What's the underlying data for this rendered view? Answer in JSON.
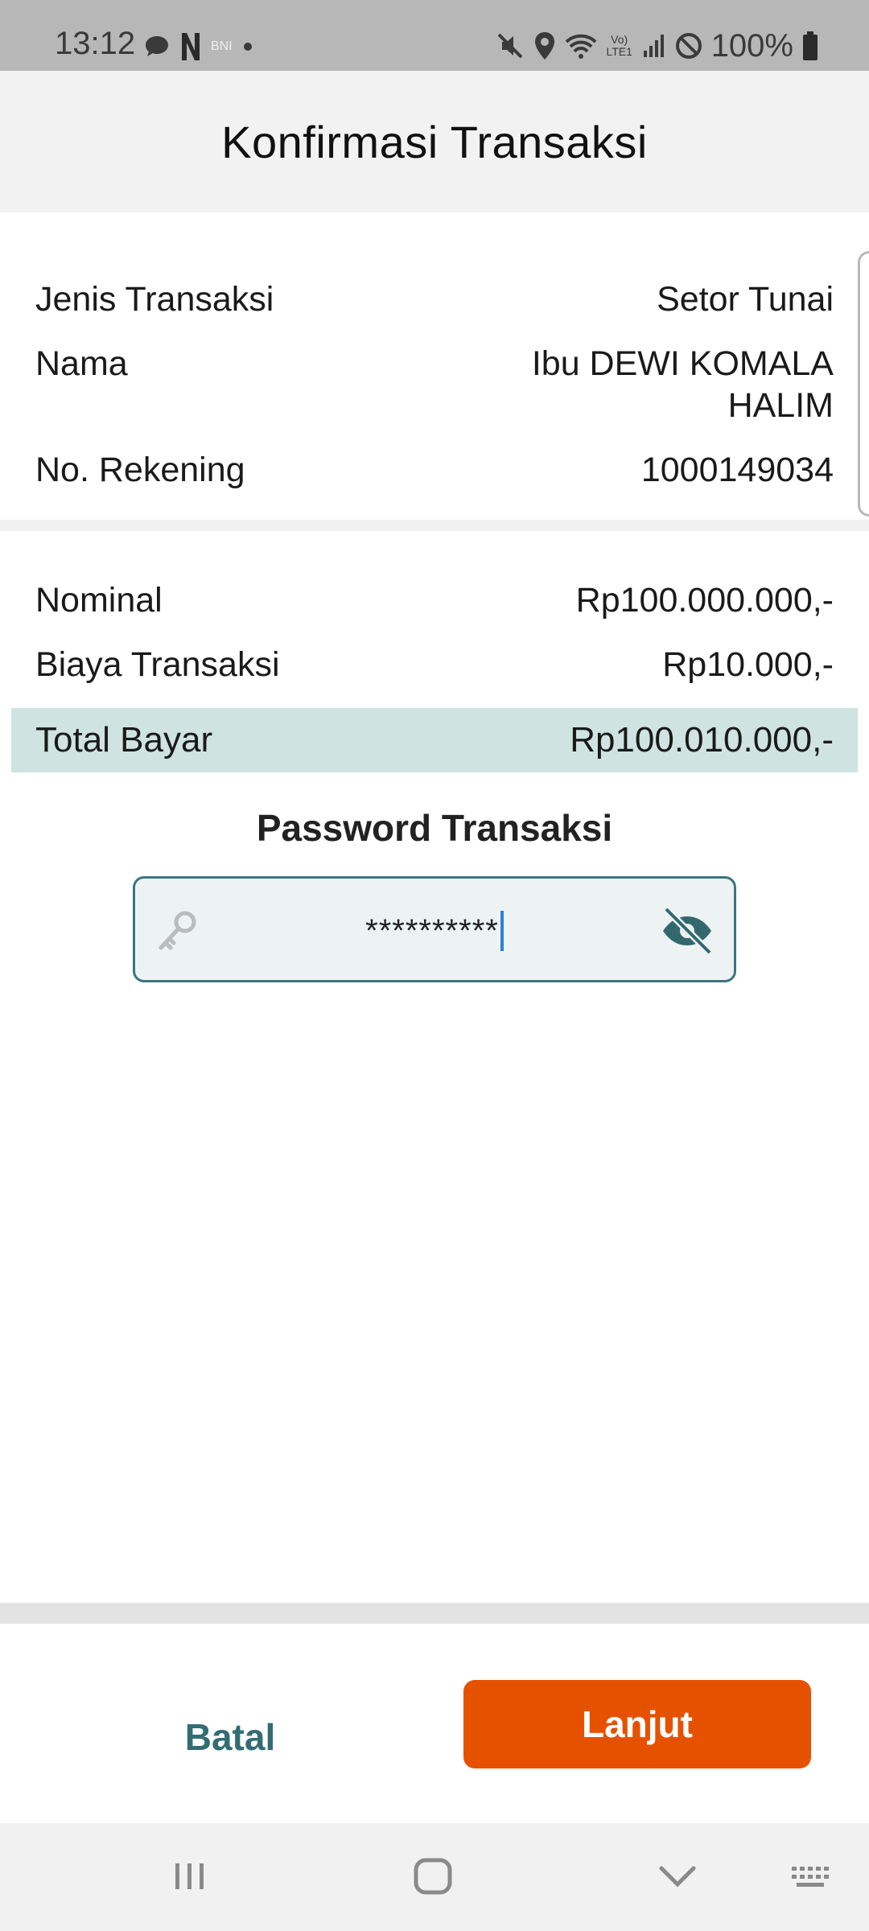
{
  "status_bar": {
    "time": "13:12",
    "carrier_label": "BNI",
    "network_label": "Vo) LTE1",
    "battery": "100%"
  },
  "header": {
    "title": "Konfirmasi Transaksi"
  },
  "details": {
    "transaction_type_label": "Jenis Transaksi",
    "transaction_type_value": "Setor Tunai",
    "name_label": "Nama",
    "name_value": "Ibu DEWI KOMALA HALIM",
    "account_label": "No. Rekening",
    "account_value": "1000149034"
  },
  "amounts": {
    "nominal_label": "Nominal",
    "nominal_value": "Rp100.000.000,-",
    "fee_label": "Biaya Transaksi",
    "fee_value": "Rp10.000,-",
    "total_label": "Total Bayar",
    "total_value": "Rp100.010.000,-"
  },
  "password": {
    "title": "Password Transaksi",
    "value": "**********"
  },
  "actions": {
    "cancel_label": "Batal",
    "next_label": "Lanjut"
  },
  "colors": {
    "accent_orange": "#e65100",
    "teal": "#336d73",
    "total_highlight": "#cfe3e0"
  }
}
